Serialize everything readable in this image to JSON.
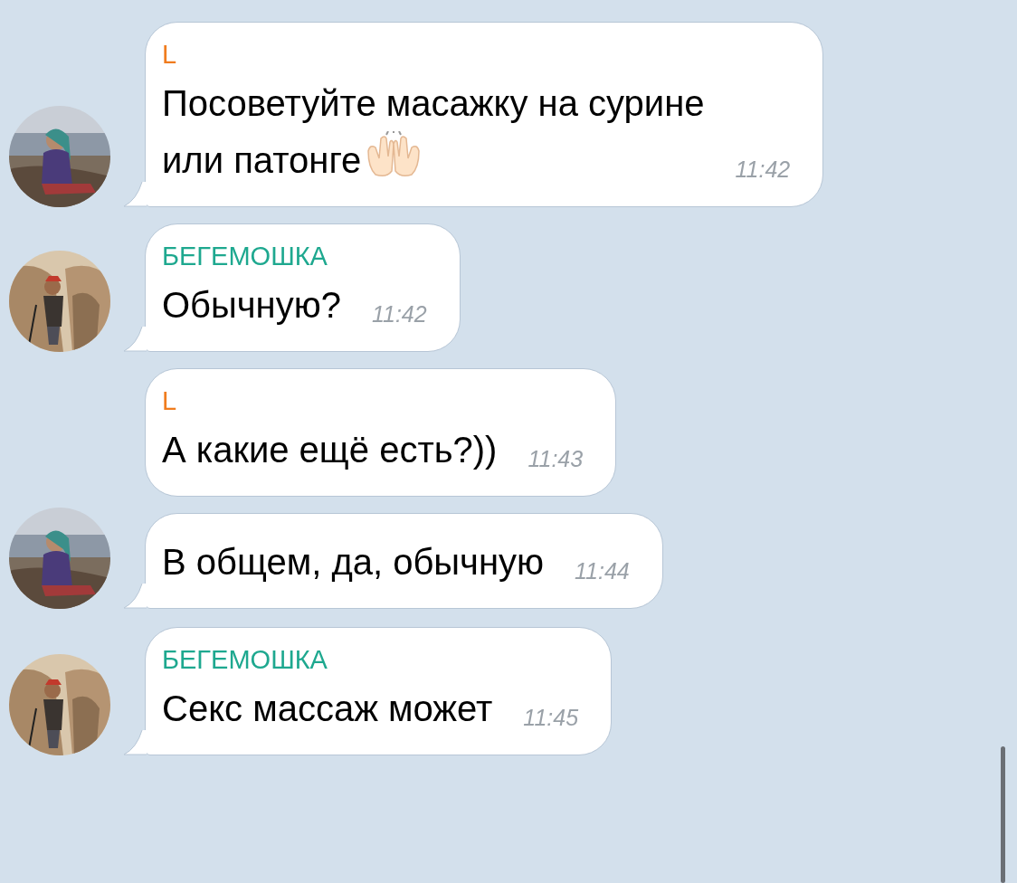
{
  "messages": [
    {
      "sender": "L",
      "color": "#f07c1e",
      "text_lines": [
        "Посоветуйте масажку на сурине",
        "или патонге"
      ],
      "raised_hands_icon": true,
      "time": "11:42",
      "tail": true,
      "avatar": {
        "kind": "sea"
      }
    },
    {
      "sender": "БЕГЕМОШКА",
      "color": "#1ea88f",
      "text_lines": [
        "Обычную?"
      ],
      "time": "11:42",
      "tail": true,
      "avatar": {
        "kind": "rocks"
      }
    },
    {
      "sender": "L",
      "color": "#f07c1e",
      "text_lines": [
        "А какие ещё есть?))"
      ],
      "time": "11:43",
      "tail": false
    },
    {
      "text_lines": [
        "В общем, да, обычную"
      ],
      "time": "11:44",
      "tail": true,
      "avatar": {
        "kind": "sea"
      }
    },
    {
      "sender": "БЕГЕМОШКА",
      "color": "#1ea88f",
      "text_lines": [
        "Секс массаж может"
      ],
      "time": "11:45",
      "tail": true,
      "avatar": {
        "kind": "rocks"
      }
    }
  ]
}
